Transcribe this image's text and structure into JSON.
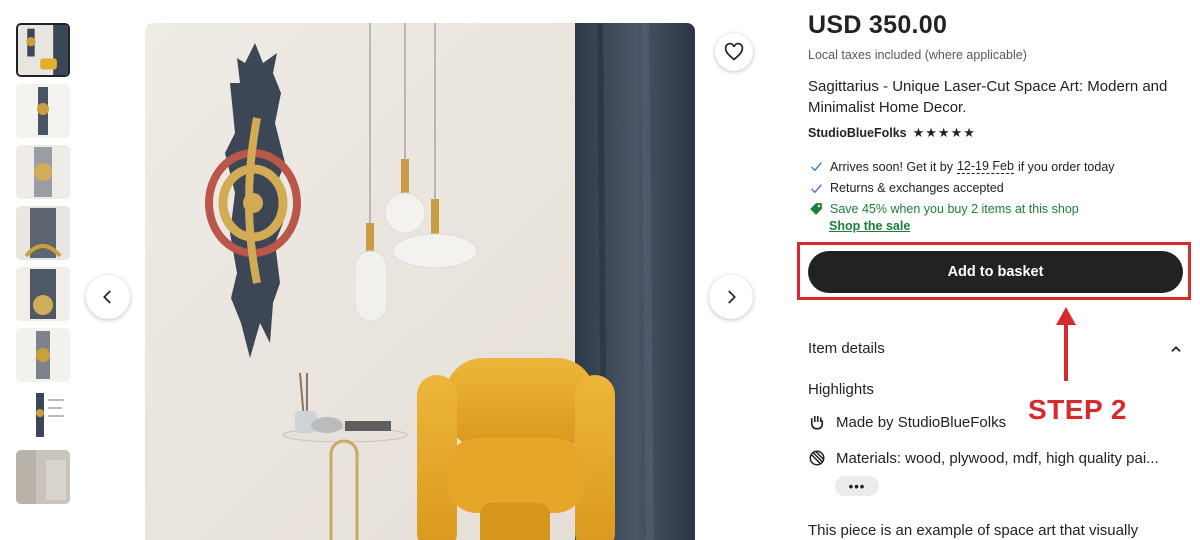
{
  "product": {
    "price": "USD 350.00",
    "taxes_note": "Local taxes included (where applicable)",
    "title": "Sagittarius - Unique Laser-Cut Space Art: Modern and Minimalist Home Decor.",
    "shop_name": "StudioBlueFolks",
    "rating_stars": "★★★★★",
    "rating_value": 5
  },
  "benefits": {
    "arrives_prefix": "Arrives soon! Get it by",
    "arrives_date": "12-19 Feb",
    "arrives_suffix": "if you order today",
    "returns": "Returns & exchanges accepted",
    "sale": "Save 45% when you buy 2 items at this shop",
    "sale_link": "Shop the sale"
  },
  "actions": {
    "add_to_basket": "Add to basket",
    "more": "•••"
  },
  "details": {
    "section_title": "Item details",
    "highlights_title": "Highlights",
    "made_by_prefix": "Made by",
    "made_by_shop": "StudioBlueFolks",
    "materials": "Materials: wood, plywood, mdf, high quality pai...",
    "description": "This piece is an example of space art that visually"
  },
  "annotation": {
    "step_label": "STEP 2",
    "color": "#d52b2f"
  },
  "gallery": {
    "thumbnail_count": 8,
    "active_index": 0
  },
  "icons": {
    "favorite": "heart-icon",
    "prev": "chevron-left-icon",
    "next": "chevron-right-icon",
    "check": "check-icon",
    "tag": "tag-icon",
    "collapse": "chevron-up-icon",
    "hand": "hand-icon",
    "materials": "materials-icon"
  }
}
